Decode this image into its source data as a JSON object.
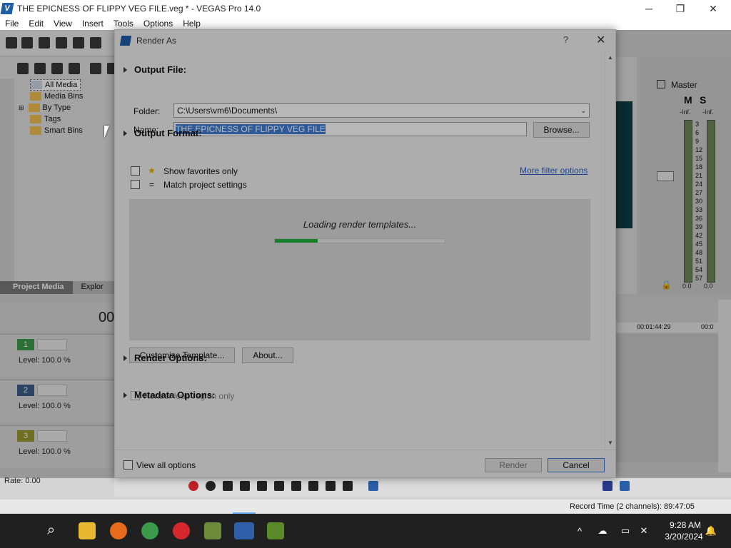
{
  "window": {
    "title": "THE EPICNESS OF FLIPPY VEG FILE.veg * - VEGAS Pro 14.0",
    "minimize": "─",
    "maximize": "❐",
    "close": "✕"
  },
  "menu": [
    "File",
    "Edit",
    "View",
    "Insert",
    "Tools",
    "Options",
    "Help"
  ],
  "media_tree": [
    "All Media",
    "Media Bins",
    "By Type",
    "Tags",
    "Smart Bins"
  ],
  "tabs": {
    "project_media": "Project Media",
    "explorer": "Explor"
  },
  "timecode_partial": "00",
  "tracks": [
    {
      "num": "1",
      "color": "#3d9b4a",
      "level": "Level: 100.0 %"
    },
    {
      "num": "2",
      "color": "#3c5f8a",
      "level": "Level: 100.0 %"
    },
    {
      "num": "3",
      "color": "#9a9a2e",
      "level": "Level: 100.0 %"
    }
  ],
  "rate": "Rate: 0.00",
  "mixer": {
    "master": "Master",
    "mute": "M",
    "solo": "S",
    "inf_left": "-Inf.",
    "inf_right": "-Inf.",
    "scale": [
      "3",
      "6",
      "9",
      "12",
      "15",
      "18",
      "21",
      "24",
      "27",
      "30",
      "33",
      "36",
      "39",
      "42",
      "45",
      "48",
      "51",
      "54",
      "57"
    ],
    "val_left": "0.0",
    "val_right": "0.0"
  },
  "timeline": {
    "marker1": "00:01:44:29",
    "marker2": "00:0"
  },
  "status": {
    "record_time": "Record Time (2 channels): 89:47:05"
  },
  "taskbar": {
    "time": "9:28 AM",
    "date": "3/20/2024"
  },
  "dialog": {
    "title": "Render As",
    "help": "?",
    "close": "✕",
    "output_file": {
      "heading": "Output File:",
      "folder_label": "Folder:",
      "folder_value": "C:\\Users\\vm6\\Documents\\",
      "name_label": "Name:",
      "name_value": "THE EPICNESS OF FLIPPY VEG FILE",
      "browse": "Browse..."
    },
    "output_format": {
      "heading": "Output Format:",
      "show_favorites": "Show favorites only",
      "match_project": "Match project settings",
      "more_filter": "More filter options",
      "loading": "Loading render templates...",
      "progress": 0.25,
      "customize": "Customize Template...",
      "about": "About..."
    },
    "render_options": {
      "heading": "Render Options:",
      "loop_region": "Render loop region only"
    },
    "metadata_options": {
      "heading": "Metadata Options:"
    },
    "footer": {
      "view_all": "View all options",
      "render": "Render",
      "cancel": "Cancel"
    }
  }
}
